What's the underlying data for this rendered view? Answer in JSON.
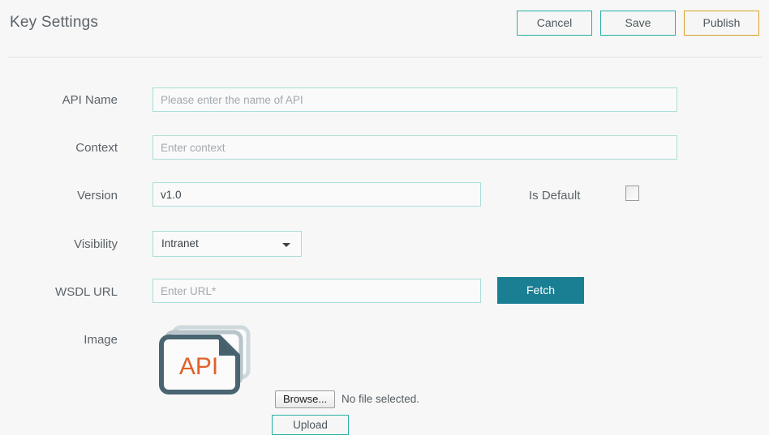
{
  "header": {
    "title": "Key Settings",
    "buttons": [
      {
        "label": "Cancel",
        "name": "cancel-button",
        "accent": "#2ab0a5"
      },
      {
        "label": "Save",
        "name": "save-button",
        "accent": "#2ab0a5"
      },
      {
        "label": "Publish",
        "name": "publish-button",
        "accent": "#d9a22b"
      }
    ]
  },
  "form": {
    "api_name": {
      "label": "API Name",
      "value": "",
      "placeholder": "Please enter the name of API"
    },
    "context": {
      "label": "Context",
      "value": "",
      "placeholder": "Enter context"
    },
    "version": {
      "label": "Version",
      "value": "v1.0",
      "placeholder": ""
    },
    "is_default": {
      "label": "Is Default",
      "checked": false
    },
    "visibility": {
      "label": "Visibility",
      "selected": "Intranet",
      "options": [
        "Intranet"
      ]
    },
    "wsdl_url": {
      "label": "WSDL URL",
      "value": "",
      "placeholder": "Enter URL*",
      "fetch_label": "Fetch"
    },
    "image": {
      "label": "Image",
      "icon_text": "API",
      "browse_label": "Browse...",
      "file_status": "No file selected.",
      "upload_label": "Upload"
    }
  },
  "colors": {
    "page_background": "#f7f7f7",
    "accent_teal": "#2ab0a5",
    "accent_orange": "#d9a22b",
    "fetch_teal": "#1a7f93",
    "input_border": "#a8ded6",
    "text": "#5b6369",
    "icon_slate": "#4a6572",
    "icon_api_orange": "#e0622a"
  }
}
